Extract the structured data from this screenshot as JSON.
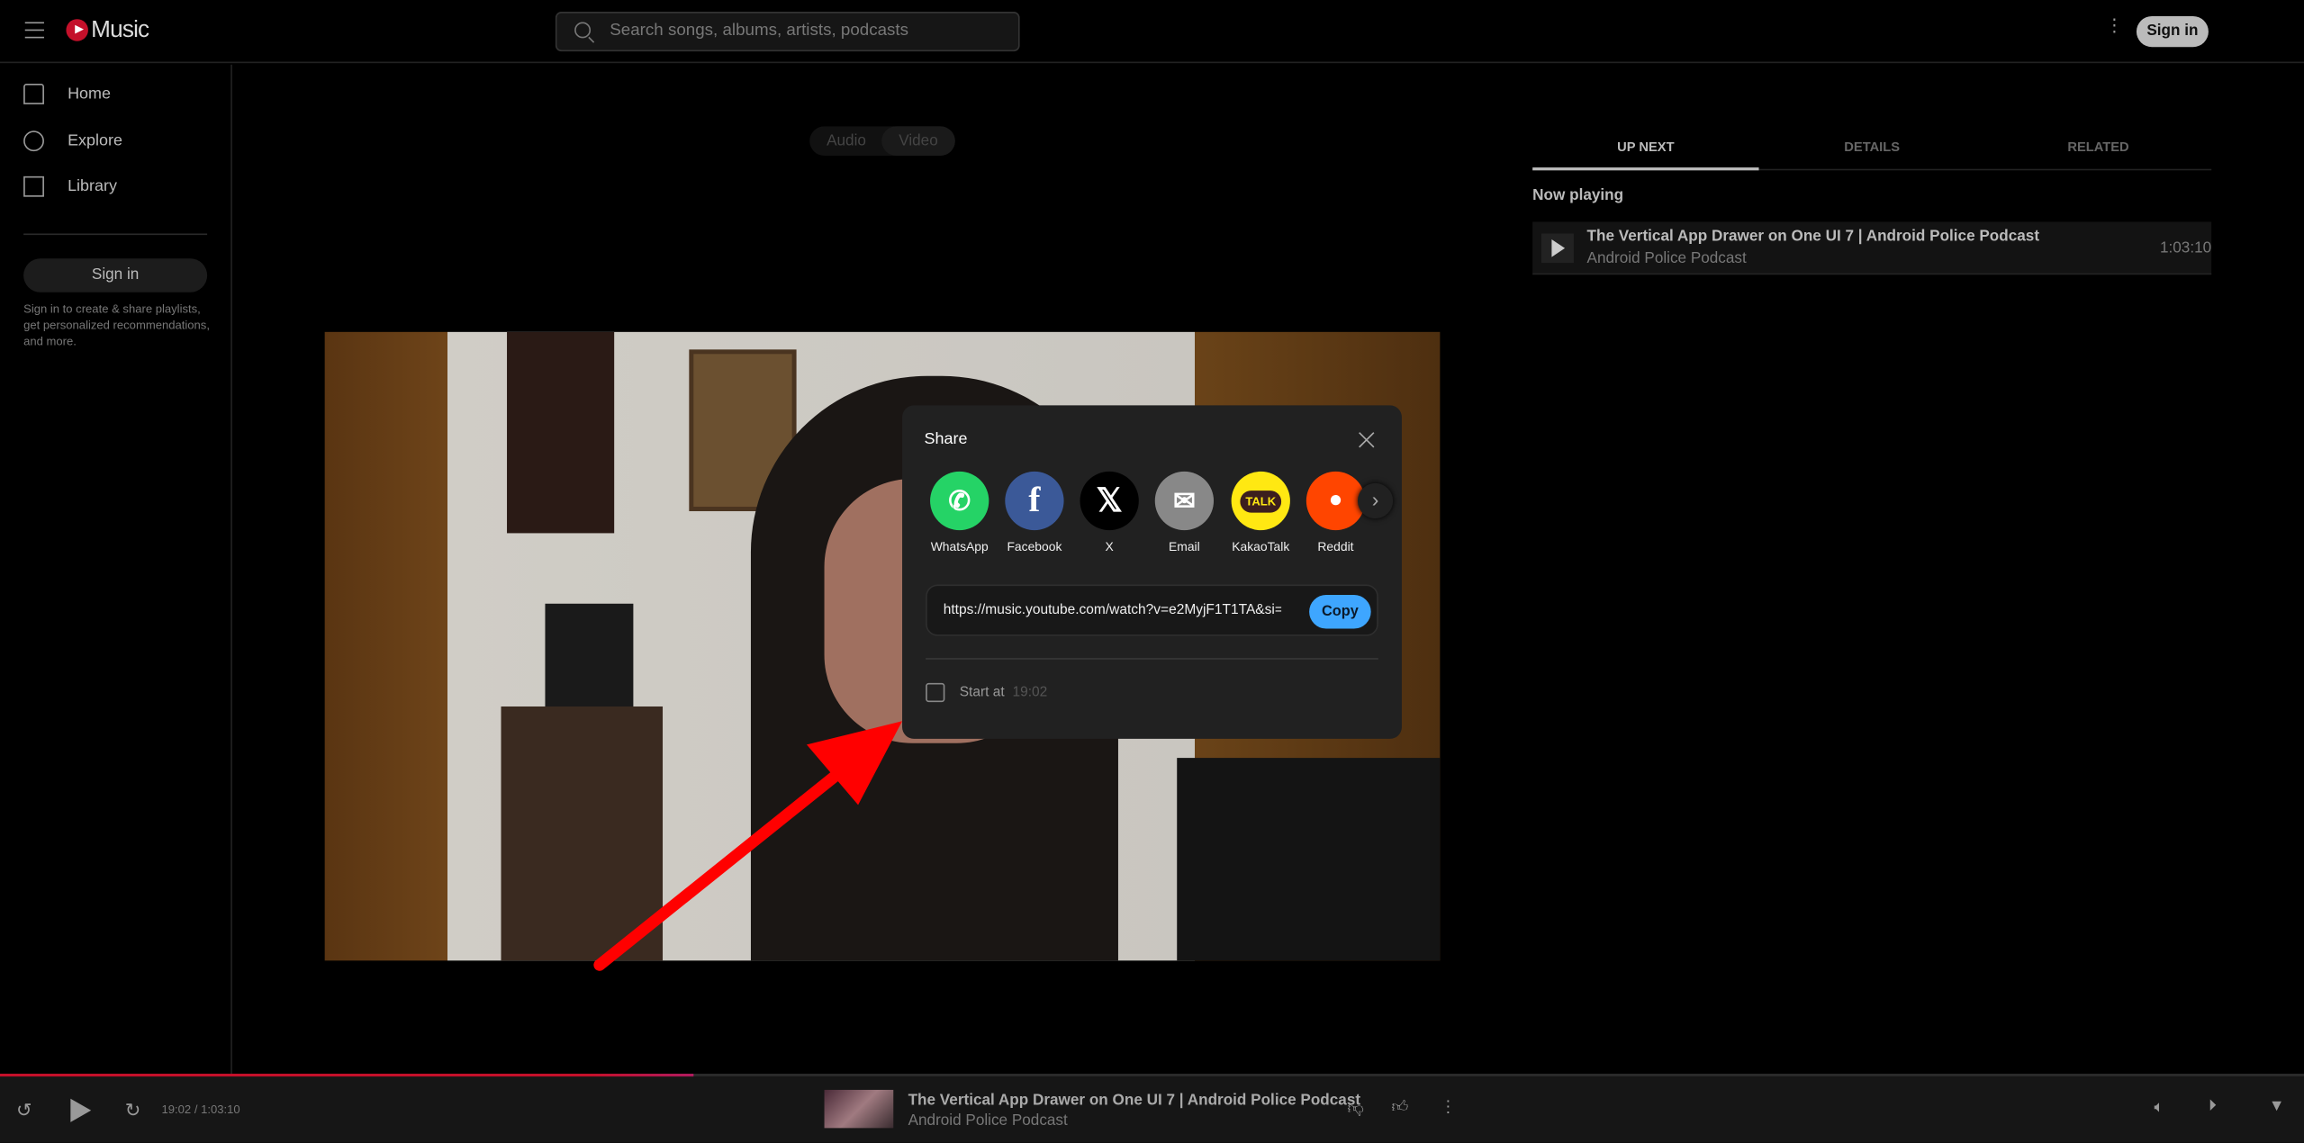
{
  "header": {
    "logo_text": "Music",
    "search_placeholder": "Search songs, albums, artists, podcasts",
    "sign_in": "Sign in"
  },
  "sidebar": {
    "items": [
      {
        "label": "Home",
        "icon": "home-icon"
      },
      {
        "label": "Explore",
        "icon": "compass-icon"
      },
      {
        "label": "Library",
        "icon": "library-icon"
      }
    ],
    "sign_in": "Sign in",
    "promo": "Sign in to create & share playlists, get personalized recommendations, and more."
  },
  "toggle": {
    "audio": "Audio",
    "video": "Video",
    "selected": "Video"
  },
  "right_panel": {
    "tabs": [
      "UP NEXT",
      "DETAILS",
      "RELATED"
    ],
    "active_tab": "UP NEXT",
    "now_playing_label": "Now playing",
    "track": {
      "title": "The Vertical App Drawer on One UI 7 | Android Police Podcast",
      "artist": "Android Police Podcast",
      "duration": "1:03:10"
    }
  },
  "share_dialog": {
    "title": "Share",
    "targets": [
      {
        "label": "WhatsApp",
        "color": "#25d366"
      },
      {
        "label": "Facebook",
        "color": "#3b5998"
      },
      {
        "label": "X",
        "color": "#000000"
      },
      {
        "label": "Email",
        "color": "#888888"
      },
      {
        "label": "KakaoTalk",
        "color": "#ffe812"
      },
      {
        "label": "Reddit",
        "color": "#ff4500"
      }
    ],
    "url": "https://music.youtube.com/watch?v=e2MyjF1T1TA&si=",
    "copy": "Copy",
    "start_at_label": "Start at",
    "start_at_time": "19:02",
    "start_at_checked": false
  },
  "player": {
    "time": "19:02 / 1:03:10",
    "progress_fraction": 0.301,
    "title": "The Vertical App Drawer on One UI 7 | Android Police Podcast",
    "artist": "Android Police Podcast",
    "accent": "#c4102a"
  }
}
